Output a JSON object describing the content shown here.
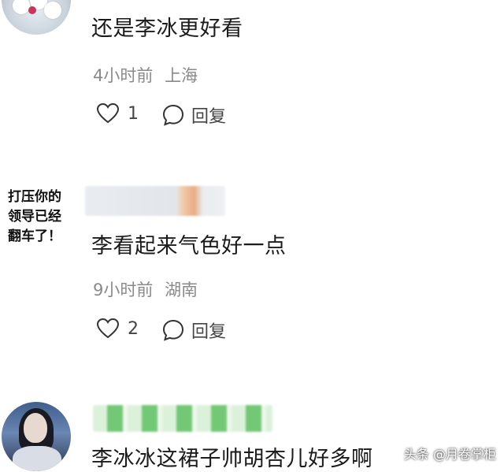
{
  "comments": [
    {
      "text": "还是李冰更好看",
      "time": "4小时前",
      "location": "上海",
      "like_count": "1",
      "reply_label": "回复"
    },
    {
      "avatar_text_lines": [
        "打压你的",
        "领导已经",
        "翻车了！"
      ],
      "text": "李看起来气色好一点",
      "time": "9小时前",
      "location": "湖南",
      "like_count": "2",
      "reply_label": "回复"
    },
    {
      "text": "李冰冰这裙子帅胡杏儿好多啊"
    }
  ],
  "watermark": "头条 @月卷掌柜",
  "icons": {
    "like": "heart-outline-icon",
    "reply": "speech-bubble-icon"
  }
}
